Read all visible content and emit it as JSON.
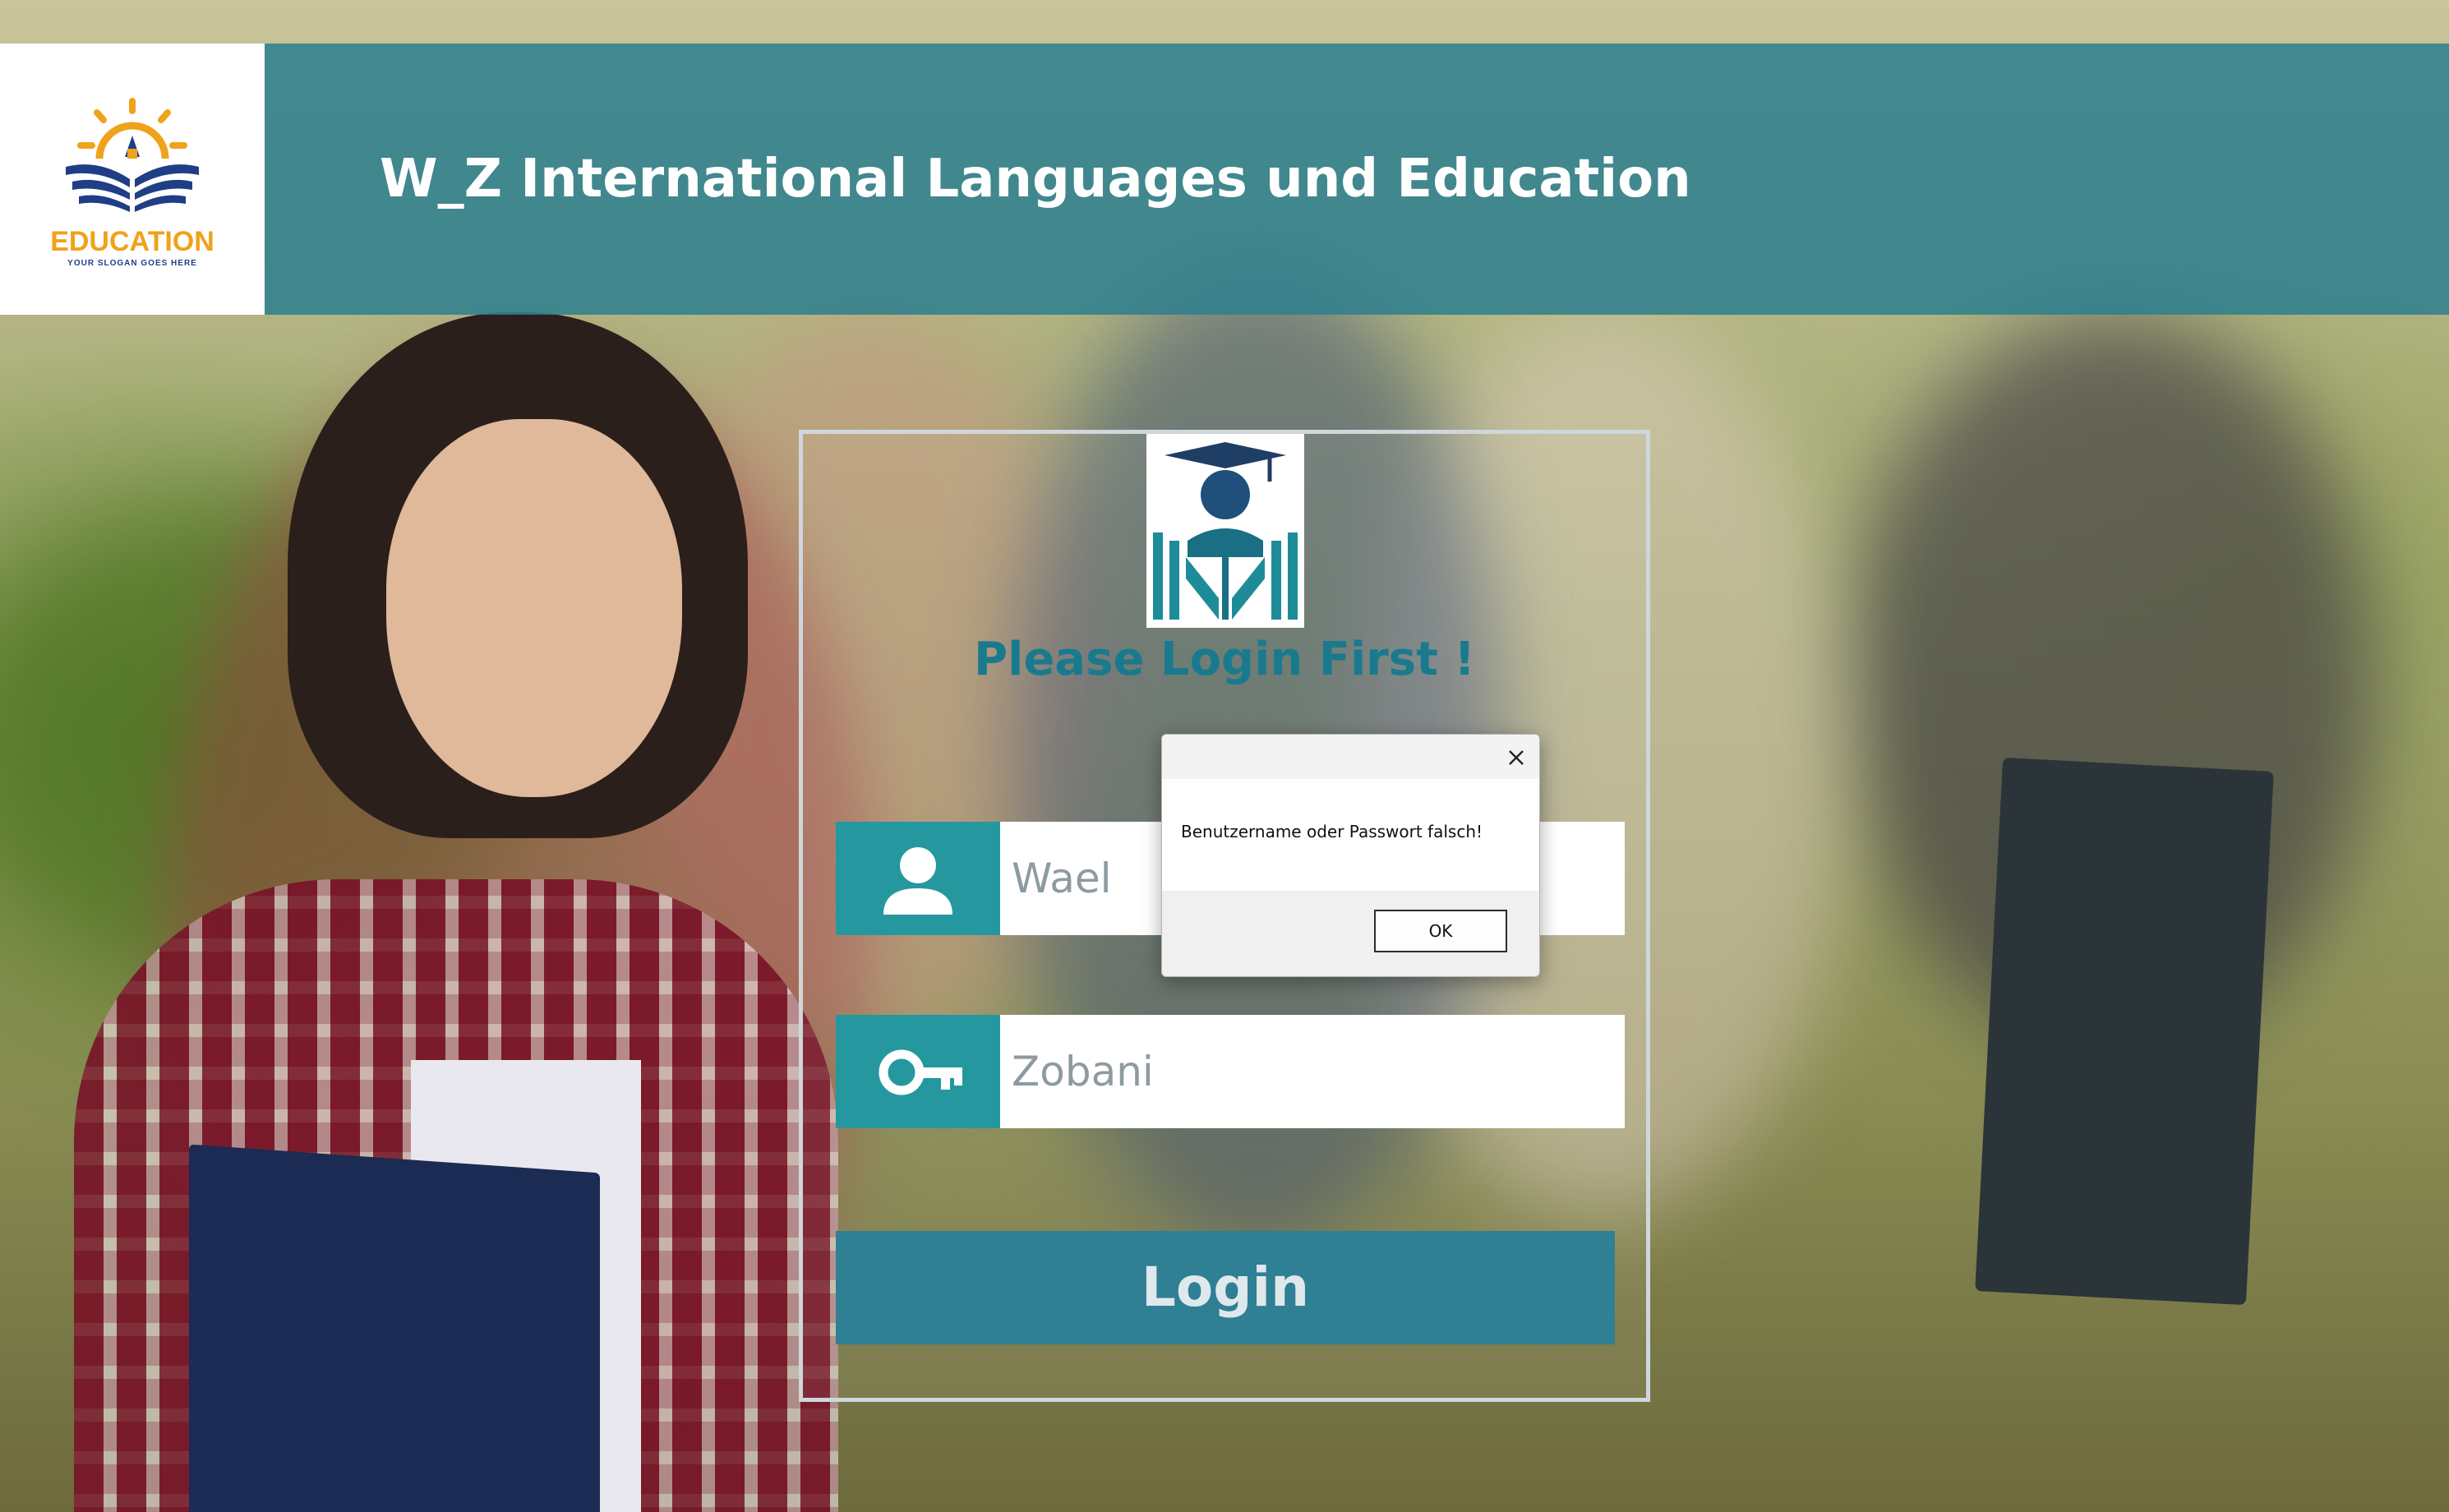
{
  "header": {
    "title": "W_Z International Languages und Education",
    "logo": {
      "main_text": "EDUCATION",
      "slogan": "YOUR SLOGAN GOES HERE"
    }
  },
  "login": {
    "heading": "Please Login First !",
    "username": {
      "value": "Wael",
      "icon": "user-icon"
    },
    "password": {
      "value": "Zobani",
      "icon": "key-icon"
    },
    "button_label": "Login"
  },
  "dialog": {
    "message": "Benutzername oder Passwort falsch!",
    "ok_label": "OK",
    "close_icon": "close-icon"
  },
  "colors": {
    "header_bar": "#30808e",
    "accent": "#25989f",
    "heading": "#197a8e",
    "login_button": "#2f7f95",
    "logo_orange": "#f0a21b",
    "logo_blue": "#1f3e86"
  }
}
